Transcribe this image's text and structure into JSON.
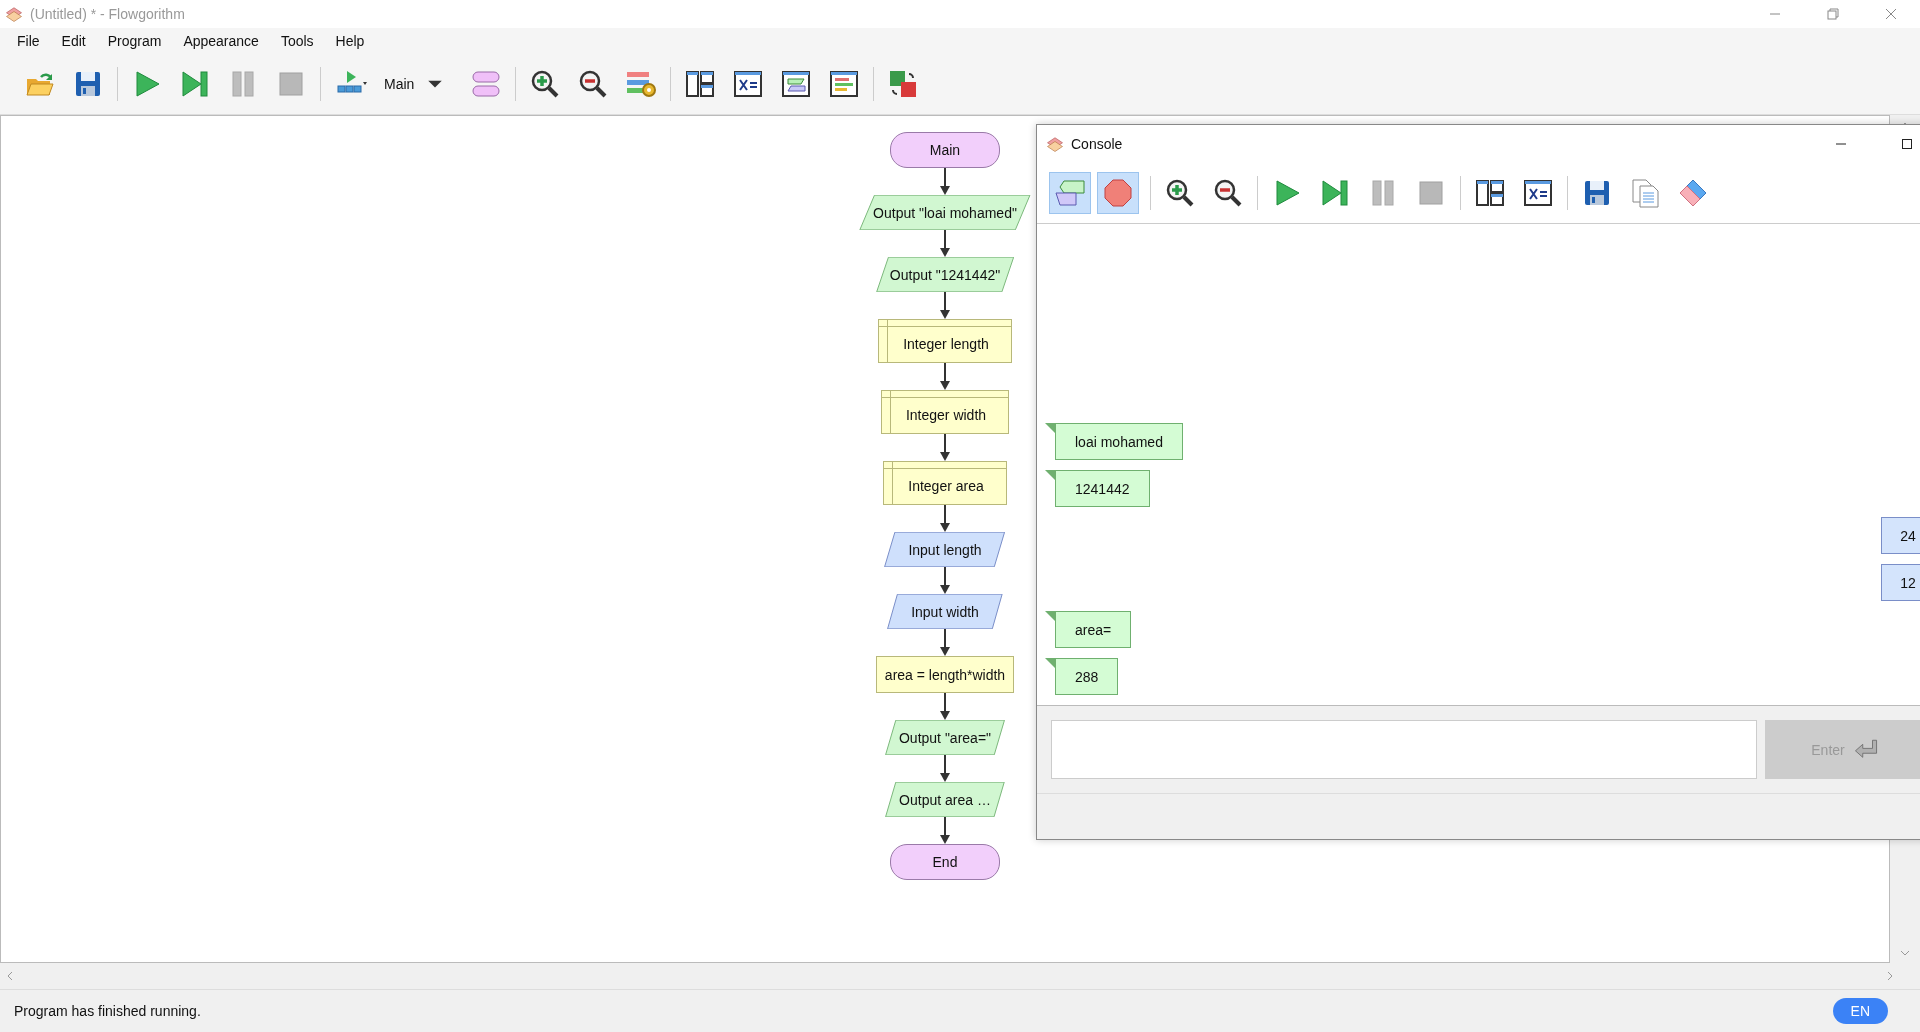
{
  "window": {
    "title": "(Untitled) * - Flowgorithm"
  },
  "menu": [
    "File",
    "Edit",
    "Program",
    "Appearance",
    "Tools",
    "Help"
  ],
  "toolbar": {
    "function_selector": "Main"
  },
  "flowchart": {
    "nodes": [
      {
        "kind": "terminal",
        "text": "Main"
      },
      {
        "kind": "output",
        "text": "Output \"loai mohamed\""
      },
      {
        "kind": "output",
        "text": "Output \"1241442\""
      },
      {
        "kind": "declare",
        "text": "Integer length"
      },
      {
        "kind": "declare",
        "text": "Integer width"
      },
      {
        "kind": "declare",
        "text": "Integer area"
      },
      {
        "kind": "input",
        "text": "Input length"
      },
      {
        "kind": "input",
        "text": "Input width"
      },
      {
        "kind": "assign",
        "text": "area = length*width"
      },
      {
        "kind": "output",
        "text": "Output \"area=\""
      },
      {
        "kind": "output",
        "text": "Output area …"
      },
      {
        "kind": "terminal",
        "text": "End"
      }
    ]
  },
  "console": {
    "title": "Console",
    "toggles": [
      {
        "kind": "bubbles",
        "on": true
      },
      {
        "kind": "stop",
        "on": true
      }
    ],
    "messages": [
      {
        "kind": "output",
        "text": "loai mohamed"
      },
      {
        "kind": "output",
        "text": "1241442"
      },
      {
        "kind": "input",
        "text": "24"
      },
      {
        "kind": "input",
        "text": "12"
      },
      {
        "kind": "output",
        "text": "area="
      },
      {
        "kind": "output",
        "text": "288"
      }
    ],
    "enter_button": {
      "label": "Enter",
      "disabled": true
    }
  },
  "status_bar": {
    "text": "Program has finished running.",
    "language": "EN"
  }
}
